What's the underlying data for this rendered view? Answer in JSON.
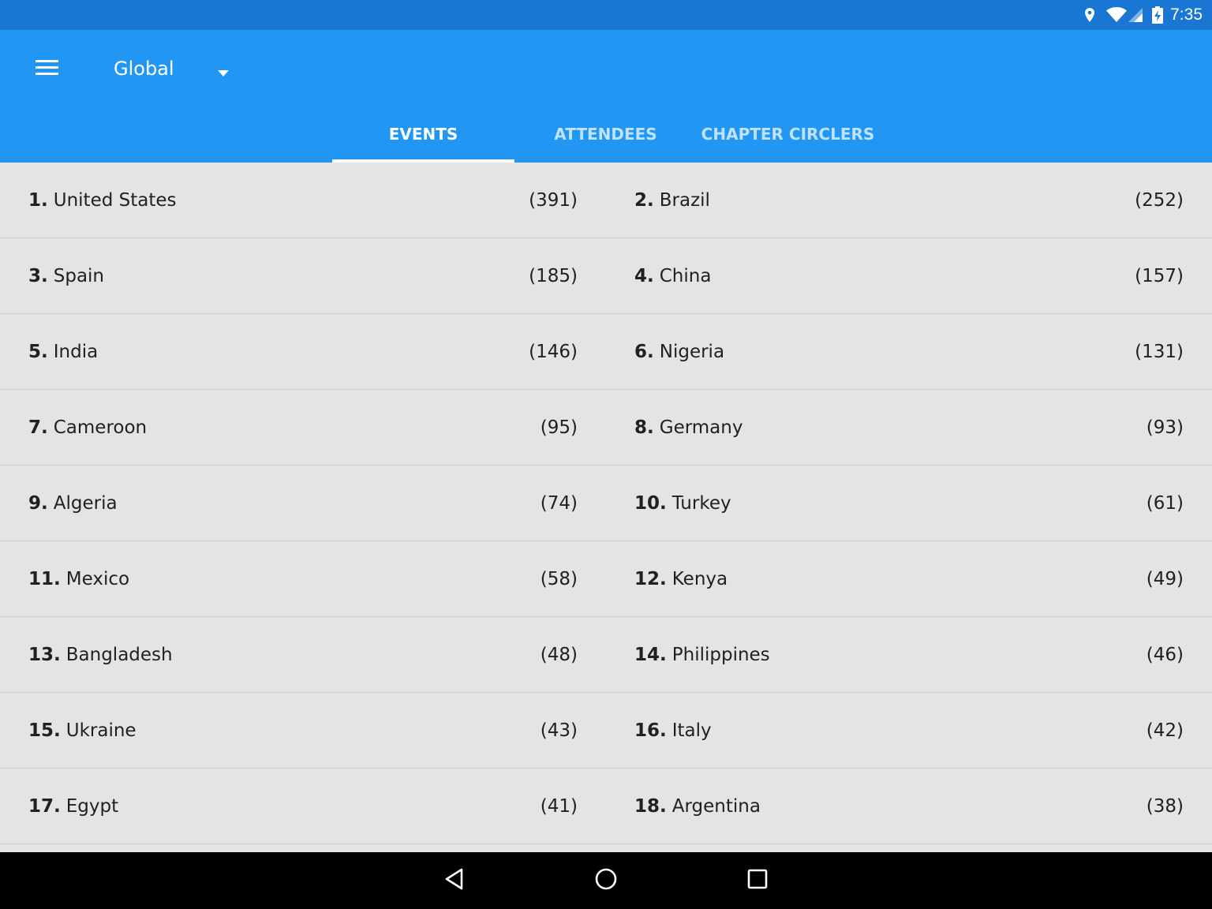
{
  "status_bar": {
    "time": "7:35",
    "icons": [
      "location-icon",
      "wifi-icon",
      "signal-icon",
      "battery-charging-icon"
    ]
  },
  "app_bar": {
    "menu_icon": "hamburger-menu-icon",
    "spinner": {
      "selected": "Global",
      "arrow_icon": "dropdown-arrow-icon"
    },
    "tabs": [
      {
        "label": "EVENTS",
        "active": true
      },
      {
        "label": "ATTENDEES",
        "active": false
      },
      {
        "label": "CHAPTER CIRCLERS",
        "active": false
      }
    ]
  },
  "rankings": [
    [
      {
        "rank": "1.",
        "name": "United States",
        "count": "(391)"
      },
      {
        "rank": "2.",
        "name": "Brazil",
        "count": "(252)"
      }
    ],
    [
      {
        "rank": "3.",
        "name": "Spain",
        "count": "(185)"
      },
      {
        "rank": "4.",
        "name": "China",
        "count": "(157)"
      }
    ],
    [
      {
        "rank": "5.",
        "name": "India",
        "count": "(146)"
      },
      {
        "rank": "6.",
        "name": "Nigeria",
        "count": "(131)"
      }
    ],
    [
      {
        "rank": "7.",
        "name": "Cameroon",
        "count": "(95)"
      },
      {
        "rank": "8.",
        "name": "Germany",
        "count": "(93)"
      }
    ],
    [
      {
        "rank": "9.",
        "name": "Algeria",
        "count": "(74)"
      },
      {
        "rank": "10.",
        "name": "Turkey",
        "count": "(61)"
      }
    ],
    [
      {
        "rank": "11.",
        "name": "Mexico",
        "count": "(58)"
      },
      {
        "rank": "12.",
        "name": "Kenya",
        "count": "(49)"
      }
    ],
    [
      {
        "rank": "13.",
        "name": "Bangladesh",
        "count": "(48)"
      },
      {
        "rank": "14.",
        "name": "Philippines",
        "count": "(46)"
      }
    ],
    [
      {
        "rank": "15.",
        "name": "Ukraine",
        "count": "(43)"
      },
      {
        "rank": "16.",
        "name": "Italy",
        "count": "(42)"
      }
    ],
    [
      {
        "rank": "17.",
        "name": "Egypt",
        "count": "(41)"
      },
      {
        "rank": "18.",
        "name": "Argentina",
        "count": "(38)"
      }
    ]
  ],
  "nav_bar": {
    "buttons": [
      "back-icon",
      "home-icon",
      "recents-icon"
    ]
  },
  "colors": {
    "status_bar": "#1976d2",
    "app_bar": "#2196f3",
    "list_background": "#e4e4e4",
    "divider": "#d0d0d0",
    "nav_bar": "#000000"
  }
}
